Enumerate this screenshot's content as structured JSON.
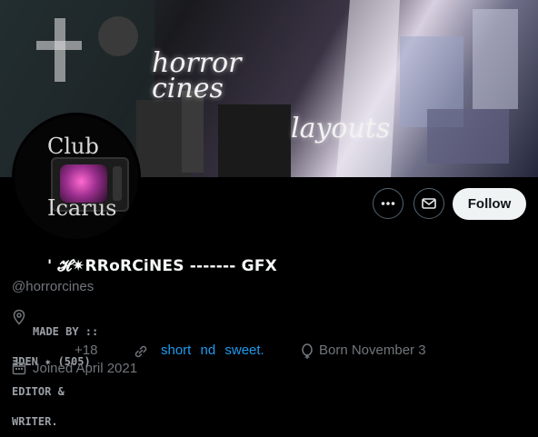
{
  "banner": {
    "title_line1": "horror",
    "title_line2": "cines",
    "subtitle": "layouts"
  },
  "avatar": {
    "line1": "Club",
    "line2": "Icarus"
  },
  "actions": {
    "more_icon": "more-icon",
    "message_icon": "envelope-icon",
    "follow_label": "Follow"
  },
  "profile": {
    "display_name": "' 𝓗✷RRoRCiNES ------- GFX",
    "handle": "@horrorcines",
    "bio_line1": "MADE BY ::",
    "bio_line2": "ƎDEN ✷ (505)",
    "bio_line3": "EDITOR &",
    "bio_line4": "WRITER.",
    "location_suffix": "+18",
    "link_text": "short nd sweet.",
    "birthday": "Born November 3",
    "joined": "Joined April 2021"
  },
  "colors": {
    "background": "#000000",
    "muted_text": "#71767b",
    "link": "#1d9bf0",
    "follow_bg": "#eff3f4"
  }
}
